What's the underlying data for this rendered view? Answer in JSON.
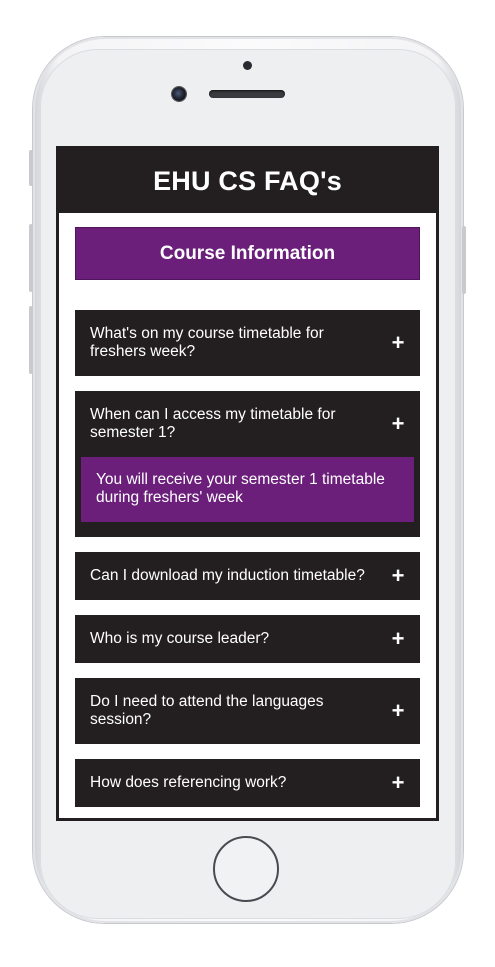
{
  "app": {
    "title": "EHU CS FAQ's"
  },
  "section": {
    "title": "Course Information"
  },
  "faqs": [
    {
      "question": "What's on my course timetable for freshers week?",
      "toggle": "+",
      "expanded": false
    },
    {
      "question": "When can I access my timetable for semester 1?",
      "toggle": "+",
      "expanded": true,
      "answer": "You will receive your semester 1 timetable during freshers' week"
    },
    {
      "question": "Can I download my induction timetable?",
      "toggle": "+",
      "expanded": false
    },
    {
      "question": "Who is my course leader?",
      "toggle": "+",
      "expanded": false
    },
    {
      "question": "Do I need to attend the languages session?",
      "toggle": "+",
      "expanded": false
    },
    {
      "question": "How does referencing work?",
      "toggle": "+",
      "expanded": false
    }
  ],
  "colors": {
    "header_bg": "#231f20",
    "accent_purple": "#6b1f7b",
    "text": "#ffffff"
  },
  "icons": {
    "toggle": "plus-icon"
  }
}
